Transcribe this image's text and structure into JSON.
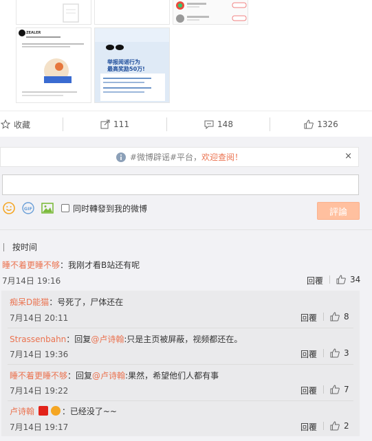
{
  "actions": {
    "favorite": "收藏",
    "repost": "111",
    "comment": "148",
    "like": "1326"
  },
  "thumbs": {
    "zealer_brand": "ZEALER",
    "poster_title": "举报阅谣行为",
    "poster_subtitle": "最高奖励50万!"
  },
  "notice": {
    "text": "#微博辟谣#平台，",
    "highlight": "欢迎查阅！",
    "close": "×"
  },
  "composer": {
    "repost_checkbox_label": "同时轉發到我的微博",
    "post_button": "評論"
  },
  "sort_label": "按时间",
  "comments": [
    {
      "user": "睡不着更睡不够",
      "text": "：我刚才看B站还有呢",
      "time": "7月14日 19:16",
      "reply": "回覆",
      "likes": "34"
    }
  ],
  "subcomments": [
    {
      "user": "痴呆D能猫",
      "text": "：号死了，尸体还在",
      "time": "7月14日 20:11",
      "reply": "回覆",
      "likes": "8"
    },
    {
      "user": "Strassenbahn",
      "pre": "：回复",
      "at": "@卢诗翰",
      "text": ":只是主页被屏蔽，视频都还在。",
      "time": "7月14日 19:36",
      "reply": "回覆",
      "likes": "3"
    },
    {
      "user": "睡不着更睡不够",
      "pre": "：回复",
      "at": "@卢诗翰",
      "text": ":果然，希望他们人都有事",
      "time": "7月14日 19:22",
      "reply": "回覆",
      "likes": "7"
    },
    {
      "user": "卢诗翰",
      "text": "：已经没了~~",
      "time": "7月14日 19:17",
      "reply": "回覆",
      "likes": "2"
    }
  ],
  "colors": {
    "accent": "#eb7350",
    "post_button": "#ffc09f"
  }
}
